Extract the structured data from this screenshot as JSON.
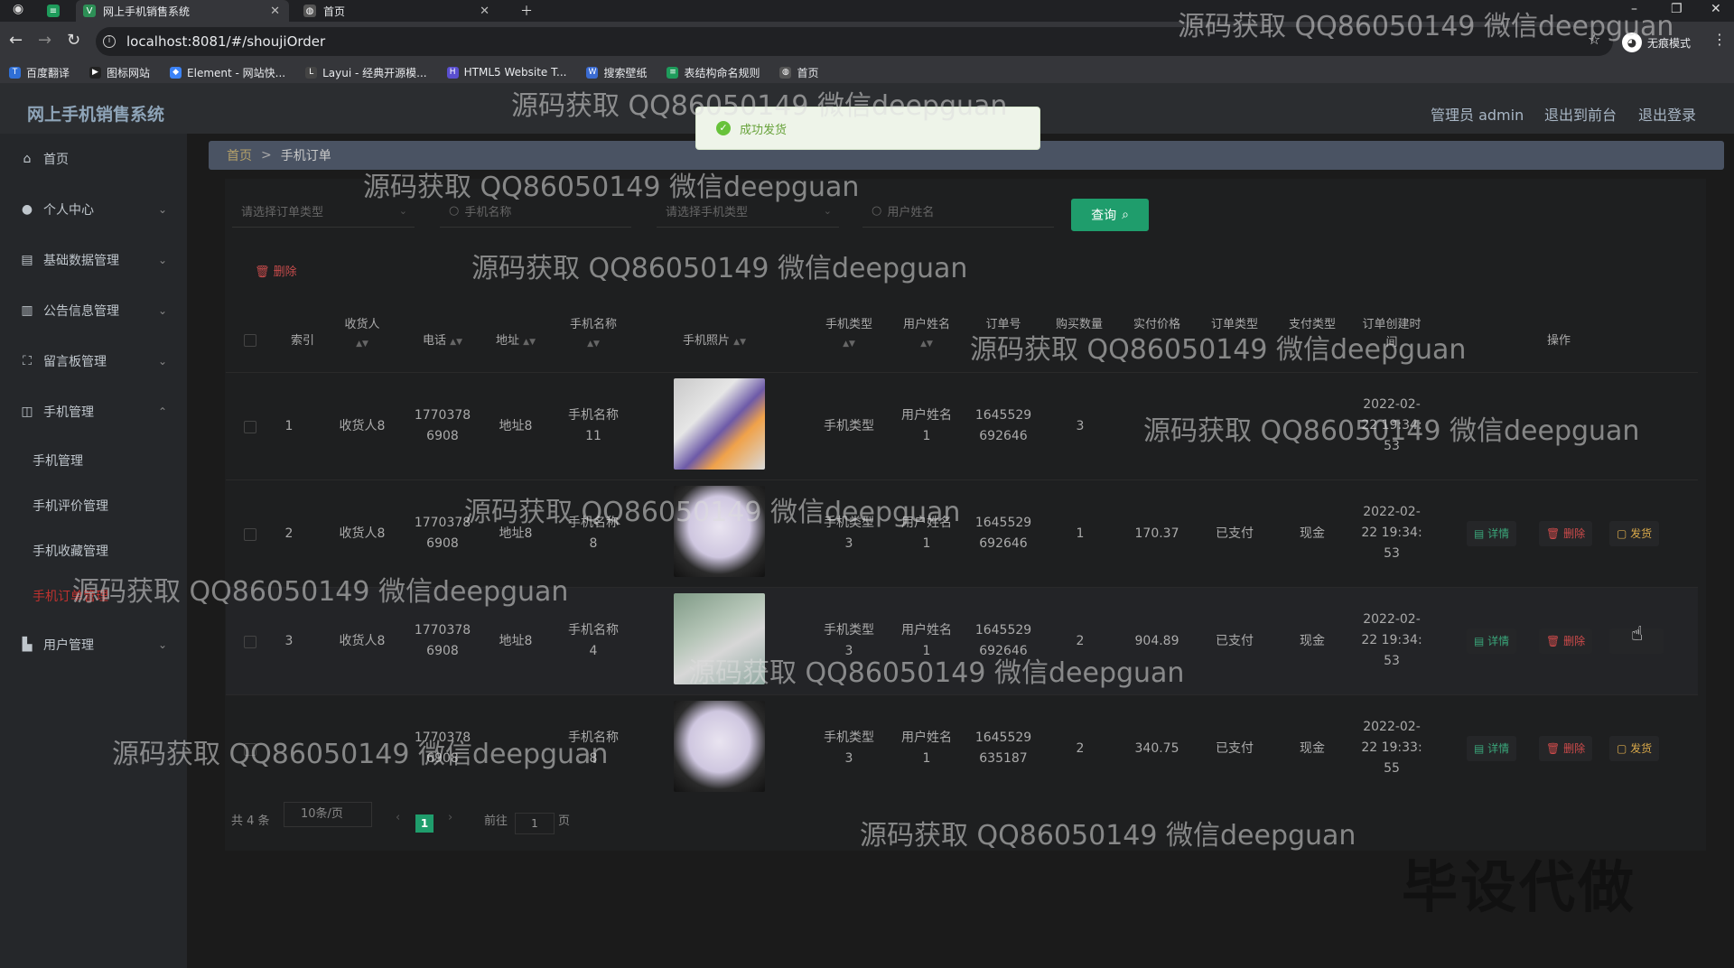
{
  "browser": {
    "tabs": [
      {
        "label": "网上手机销售系统",
        "active": true
      },
      {
        "label": "首页",
        "active": false
      }
    ],
    "url": "localhost:8081/#/shoujiOrder",
    "profile_label": "无痕模式",
    "bookmarks": [
      "百度翻译",
      "图标网站",
      "Element - 网站快...",
      "Layui - 经典开源模...",
      "HTML5 Website T...",
      "搜索壁纸",
      "表结构命名规则",
      "首页"
    ]
  },
  "header": {
    "title": "网上手机销售系统",
    "admin_label": "管理员 admin",
    "frontend_label": "退出到前台",
    "logout_label": "退出登录"
  },
  "toast": {
    "message": "成功发货"
  },
  "sidebar": {
    "items": [
      {
        "label": "首页",
        "icon": "home-icon"
      },
      {
        "label": "个人中心",
        "icon": "user-icon"
      },
      {
        "label": "基础数据管理",
        "icon": "data-icon"
      },
      {
        "label": "公告信息管理",
        "icon": "chart-icon"
      },
      {
        "label": "留言板管理",
        "icon": "message-icon"
      },
      {
        "label": "手机管理",
        "icon": "phone-icon"
      },
      {
        "label": "用户管理",
        "icon": "users-icon"
      }
    ],
    "sub_items": [
      "手机管理",
      "手机评价管理",
      "手机收藏管理",
      "手机订单管理"
    ]
  },
  "breadcrumb": {
    "home": "首页",
    "separator": ">",
    "current": "手机订单"
  },
  "filters": {
    "order_type_placeholder": "请选择订单类型",
    "phone_name_placeholder": "手机名称",
    "phone_type_placeholder": "请选择手机类型",
    "user_name_placeholder": "用户姓名",
    "search_label": "查询"
  },
  "delete_label": "删除",
  "table": {
    "headers": [
      "索引",
      "收货人",
      "电话",
      "地址",
      "手机名称",
      "手机照片",
      "手机类型",
      "用户姓名",
      "订单号",
      "购买数量",
      "实付价格",
      "订单类型",
      "支付类型",
      "订单创建时间",
      "操作"
    ],
    "rows": [
      {
        "index": "1",
        "receiver": "收货人8",
        "phone1": "1770378",
        "phone2": "6908",
        "address": "地址8",
        "name1": "手机名称",
        "name2": "11",
        "type1": "手机类型",
        "type2": "3",
        "user1": "用户姓名",
        "user2": "1",
        "order1": "1645529",
        "order2": "692646",
        "qty": "3",
        "price": "",
        "otype": "",
        "ptype": "",
        "time1": "2022-02-",
        "time2": "22 19:34:",
        "time3": "53"
      },
      {
        "index": "2",
        "receiver": "收货人8",
        "phone1": "1770378",
        "phone2": "6908",
        "address": "地址8",
        "name1": "手机名称",
        "name2": "8",
        "type1": "手机类型",
        "type2": "3",
        "user1": "用户姓名",
        "user2": "1",
        "order1": "1645529",
        "order2": "692646",
        "qty": "1",
        "price": "170.37",
        "otype": "已支付",
        "ptype": "现金",
        "time1": "2022-02-",
        "time2": "22 19:34:",
        "time3": "53"
      },
      {
        "index": "3",
        "receiver": "收货人8",
        "phone1": "1770378",
        "phone2": "6908",
        "address": "地址8",
        "name1": "手机名称",
        "name2": "4",
        "type1": "手机类型",
        "type2": "3",
        "user1": "用户姓名",
        "user2": "1",
        "order1": "1645529",
        "order2": "692646",
        "qty": "2",
        "price": "904.89",
        "otype": "已支付",
        "ptype": "现金",
        "time1": "2022-02-",
        "time2": "22 19:34:",
        "time3": "53"
      },
      {
        "index": "4",
        "receiver": "收货人8",
        "phone1": "1770378",
        "phone2": "6908",
        "address": "地址8",
        "name1": "手机名称",
        "name2": "8",
        "type1": "手机类型",
        "type2": "3",
        "user1": "用户姓名",
        "user2": "1",
        "order1": "1645529",
        "order2": "635187",
        "qty": "2",
        "price": "340.75",
        "otype": "已支付",
        "ptype": "现金",
        "time1": "2022-02-",
        "time2": "22 19:33:",
        "time3": "55"
      }
    ],
    "actions": {
      "detail": "详情",
      "delete": "删除",
      "ship": "发货"
    }
  },
  "pagination": {
    "total": "共 4 条",
    "page_size": "10条/页",
    "current_page": "1",
    "goto_prefix": "前往",
    "goto_value": "1",
    "goto_suffix": "页"
  },
  "watermarks": [
    "源码获取 QQ86050149 微信deepguan",
    "毕设代做"
  ],
  "colors": {
    "accent": "#1f9d6c",
    "danger": "#cf4b4b",
    "warning": "#d8a84a",
    "success": "#67c23a"
  }
}
